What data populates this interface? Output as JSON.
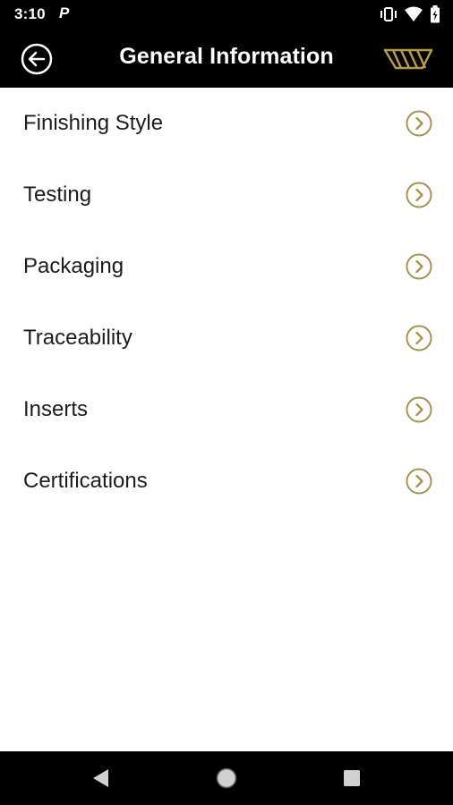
{
  "status_bar": {
    "time": "3:10",
    "notification_icon": "P"
  },
  "app_bar": {
    "title": "General Information",
    "back_icon": "arrow-left-circle-icon",
    "logo_icon": "brand-logo-icon"
  },
  "menu": {
    "items": [
      {
        "label": "Finishing Style"
      },
      {
        "label": "Testing"
      },
      {
        "label": "Packaging"
      },
      {
        "label": "Traceability"
      },
      {
        "label": "Inserts"
      },
      {
        "label": "Certifications"
      }
    ]
  },
  "colors": {
    "accent": "#a8924e",
    "bar_background": "#000000",
    "text": "#1c1c1c"
  },
  "nav_bar": {
    "back_icon": "nav-back-icon",
    "home_icon": "nav-home-icon",
    "recents_icon": "nav-recents-icon"
  }
}
